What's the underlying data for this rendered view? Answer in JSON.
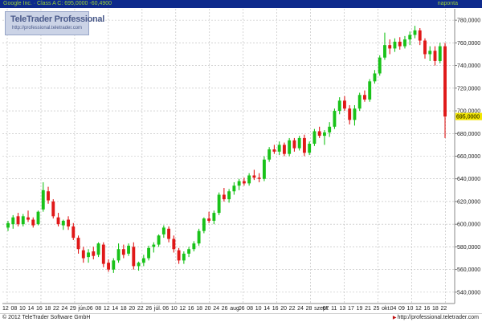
{
  "header": {
    "symbol_text": "Google Inc. · Class A C: 695,0000 -60,4900",
    "period": "napontа"
  },
  "watermark": {
    "brand": "TeleTrader Professional",
    "url": "http://professional.teletrader.com"
  },
  "footer": {
    "copyright": "© 2012 TeleTrader Software GmbH",
    "url": "http://professional.teletrader.com"
  },
  "colors": {
    "up": "#19c219",
    "down": "#e01818",
    "grid": "#b9b9b9",
    "axis_bg": "#ffffff",
    "header_bg": "#0e2a8c",
    "last_price_bg": "#f2e600"
  },
  "chart_data": {
    "type": "candlestick",
    "ylim": [
      530,
      790
    ],
    "y_ticks": [
      540,
      560,
      580,
      600,
      620,
      640,
      660,
      680,
      700,
      720,
      740,
      760,
      780
    ],
    "y_tick_labels": [
      "540,0000",
      "560,0000",
      "580,0000",
      "600,0000",
      "620,0000",
      "640,0000",
      "660,0000",
      "680,0000",
      "700,0000",
      "720,0000",
      "740,0000",
      "760,0000",
      "780,0000"
    ],
    "last_price": 695,
    "last_price_label": "695,0000",
    "x_tick_labels": [
      "12",
      "08",
      "10",
      "14",
      "16",
      "18",
      "22",
      "24",
      "29",
      "jún.",
      "06",
      "08",
      "12",
      "14",
      "18",
      "20",
      "22",
      "26",
      "júl.",
      "06",
      "10",
      "12",
      "16",
      "18",
      "20",
      "24",
      "26",
      "aug.",
      "06",
      "08",
      "10",
      "14",
      "16",
      "20",
      "22",
      "24",
      "28",
      "szept.",
      "07",
      "11",
      "13",
      "17",
      "19",
      "21",
      "25",
      "okt.",
      "04",
      "09",
      "10",
      "12",
      "16",
      "18",
      "22"
    ],
    "candles": [
      {
        "o": 597,
        "h": 603,
        "l": 594,
        "c": 601
      },
      {
        "o": 600,
        "h": 608,
        "l": 596,
        "c": 606
      },
      {
        "o": 607,
        "h": 610,
        "l": 598,
        "c": 600
      },
      {
        "o": 600,
        "h": 609,
        "l": 598,
        "c": 607
      },
      {
        "o": 606,
        "h": 612,
        "l": 602,
        "c": 604
      },
      {
        "o": 604,
        "h": 606,
        "l": 597,
        "c": 599
      },
      {
        "o": 600,
        "h": 612,
        "l": 599,
        "c": 611
      },
      {
        "o": 613,
        "h": 637,
        "l": 611,
        "c": 630
      },
      {
        "o": 629,
        "h": 633,
        "l": 618,
        "c": 621
      },
      {
        "o": 620,
        "h": 622,
        "l": 605,
        "c": 607
      },
      {
        "o": 606,
        "h": 610,
        "l": 598,
        "c": 600
      },
      {
        "o": 599,
        "h": 604,
        "l": 595,
        "c": 603
      },
      {
        "o": 604,
        "h": 607,
        "l": 595,
        "c": 598
      },
      {
        "o": 598,
        "h": 601,
        "l": 586,
        "c": 588
      },
      {
        "o": 588,
        "h": 590,
        "l": 574,
        "c": 578
      },
      {
        "o": 577,
        "h": 580,
        "l": 566,
        "c": 570
      },
      {
        "o": 571,
        "h": 578,
        "l": 566,
        "c": 575
      },
      {
        "o": 576,
        "h": 580,
        "l": 569,
        "c": 572
      },
      {
        "o": 573,
        "h": 584,
        "l": 571,
        "c": 583
      },
      {
        "o": 582,
        "h": 584,
        "l": 562,
        "c": 565
      },
      {
        "o": 566,
        "h": 569,
        "l": 558,
        "c": 560
      },
      {
        "o": 560,
        "h": 570,
        "l": 557,
        "c": 568
      },
      {
        "o": 568,
        "h": 583,
        "l": 566,
        "c": 578
      },
      {
        "o": 578,
        "h": 582,
        "l": 570,
        "c": 573
      },
      {
        "o": 574,
        "h": 583,
        "l": 572,
        "c": 581
      },
      {
        "o": 580,
        "h": 584,
        "l": 560,
        "c": 563
      },
      {
        "o": 563,
        "h": 567,
        "l": 559,
        "c": 566
      },
      {
        "o": 566,
        "h": 573,
        "l": 563,
        "c": 570
      },
      {
        "o": 570,
        "h": 581,
        "l": 568,
        "c": 579
      },
      {
        "o": 580,
        "h": 584,
        "l": 575,
        "c": 582
      },
      {
        "o": 582,
        "h": 591,
        "l": 580,
        "c": 590
      },
      {
        "o": 591,
        "h": 599,
        "l": 588,
        "c": 597
      },
      {
        "o": 596,
        "h": 598,
        "l": 584,
        "c": 587
      },
      {
        "o": 587,
        "h": 590,
        "l": 575,
        "c": 578
      },
      {
        "o": 577,
        "h": 579,
        "l": 565,
        "c": 568
      },
      {
        "o": 568,
        "h": 576,
        "l": 565,
        "c": 574
      },
      {
        "o": 574,
        "h": 580,
        "l": 571,
        "c": 578
      },
      {
        "o": 578,
        "h": 585,
        "l": 576,
        "c": 583
      },
      {
        "o": 583,
        "h": 596,
        "l": 581,
        "c": 594
      },
      {
        "o": 594,
        "h": 606,
        "l": 592,
        "c": 605
      },
      {
        "o": 605,
        "h": 611,
        "l": 601,
        "c": 603
      },
      {
        "o": 603,
        "h": 612,
        "l": 600,
        "c": 610
      },
      {
        "o": 610,
        "h": 628,
        "l": 608,
        "c": 626
      },
      {
        "o": 626,
        "h": 632,
        "l": 620,
        "c": 622
      },
      {
        "o": 622,
        "h": 631,
        "l": 619,
        "c": 629
      },
      {
        "o": 629,
        "h": 637,
        "l": 626,
        "c": 634
      },
      {
        "o": 634,
        "h": 640,
        "l": 630,
        "c": 638
      },
      {
        "o": 638,
        "h": 641,
        "l": 634,
        "c": 636
      },
      {
        "o": 636,
        "h": 645,
        "l": 634,
        "c": 643
      },
      {
        "o": 643,
        "h": 648,
        "l": 639,
        "c": 641
      },
      {
        "o": 641,
        "h": 645,
        "l": 637,
        "c": 640
      },
      {
        "o": 640,
        "h": 660,
        "l": 638,
        "c": 657
      },
      {
        "o": 657,
        "h": 668,
        "l": 655,
        "c": 666
      },
      {
        "o": 666,
        "h": 670,
        "l": 662,
        "c": 664
      },
      {
        "o": 664,
        "h": 673,
        "l": 661,
        "c": 670
      },
      {
        "o": 670,
        "h": 672,
        "l": 660,
        "c": 662
      },
      {
        "o": 662,
        "h": 676,
        "l": 660,
        "c": 674
      },
      {
        "o": 674,
        "h": 676,
        "l": 664,
        "c": 667
      },
      {
        "o": 667,
        "h": 678,
        "l": 665,
        "c": 676
      },
      {
        "o": 676,
        "h": 679,
        "l": 660,
        "c": 663
      },
      {
        "o": 663,
        "h": 673,
        "l": 661,
        "c": 671
      },
      {
        "o": 671,
        "h": 684,
        "l": 669,
        "c": 682
      },
      {
        "o": 682,
        "h": 686,
        "l": 676,
        "c": 678
      },
      {
        "o": 678,
        "h": 683,
        "l": 670,
        "c": 681
      },
      {
        "o": 681,
        "h": 690,
        "l": 677,
        "c": 686
      },
      {
        "o": 686,
        "h": 702,
        "l": 684,
        "c": 700
      },
      {
        "o": 700,
        "h": 712,
        "l": 697,
        "c": 709
      },
      {
        "o": 709,
        "h": 713,
        "l": 700,
        "c": 702
      },
      {
        "o": 702,
        "h": 705,
        "l": 688,
        "c": 692
      },
      {
        "o": 692,
        "h": 705,
        "l": 687,
        "c": 702
      },
      {
        "o": 702,
        "h": 716,
        "l": 700,
        "c": 714
      },
      {
        "o": 714,
        "h": 718,
        "l": 708,
        "c": 710
      },
      {
        "o": 710,
        "h": 728,
        "l": 708,
        "c": 726
      },
      {
        "o": 726,
        "h": 736,
        "l": 724,
        "c": 733
      },
      {
        "o": 733,
        "h": 749,
        "l": 731,
        "c": 747
      },
      {
        "o": 747,
        "h": 769,
        "l": 745,
        "c": 758
      },
      {
        "o": 758,
        "h": 763,
        "l": 750,
        "c": 755
      },
      {
        "o": 755,
        "h": 764,
        "l": 752,
        "c": 761
      },
      {
        "o": 761,
        "h": 765,
        "l": 754,
        "c": 757
      },
      {
        "o": 757,
        "h": 766,
        "l": 755,
        "c": 763
      },
      {
        "o": 763,
        "h": 770,
        "l": 758,
        "c": 767
      },
      {
        "o": 767,
        "h": 775,
        "l": 764,
        "c": 771
      },
      {
        "o": 771,
        "h": 773,
        "l": 758,
        "c": 762
      },
      {
        "o": 762,
        "h": 764,
        "l": 746,
        "c": 750
      },
      {
        "o": 750,
        "h": 757,
        "l": 744,
        "c": 753
      },
      {
        "o": 753,
        "h": 757,
        "l": 740,
        "c": 744
      },
      {
        "o": 744,
        "h": 760,
        "l": 742,
        "c": 757
      },
      {
        "o": 757,
        "h": 760,
        "l": 676,
        "c": 695
      }
    ]
  }
}
